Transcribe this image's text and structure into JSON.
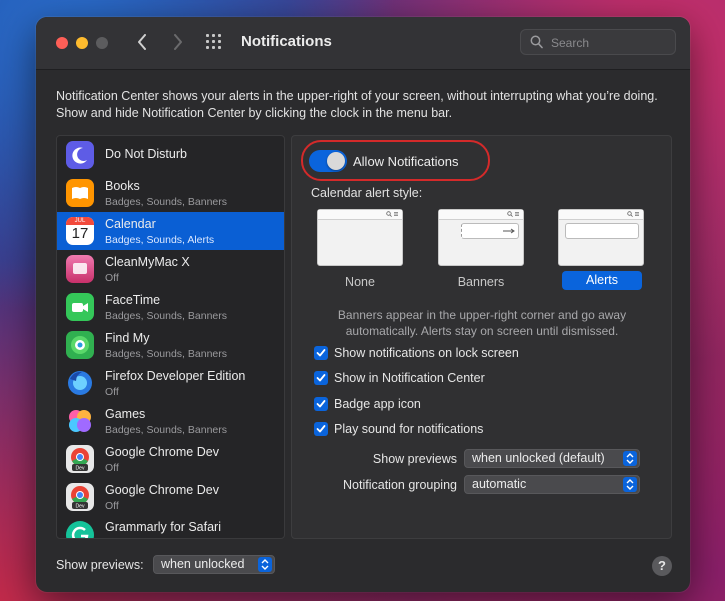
{
  "window": {
    "title": "Notifications"
  },
  "search": {
    "placeholder": "Search"
  },
  "description": "Notification Center shows your alerts in the upper-right of your screen, without interrupting what you’re doing. Show and hide Notification Center by clicking the clock in the menu bar.",
  "apps": [
    {
      "name": "Do Not Disturb",
      "sub": "",
      "icon": "moon-icon",
      "color": "#5e5ce6"
    },
    {
      "name": "Books",
      "sub": "Badges, Sounds, Banners",
      "icon": "books-icon",
      "color": "#ff9500"
    },
    {
      "name": "Calendar",
      "sub": "Badges, Sounds, Alerts",
      "icon": "calendar-icon",
      "color": "#ffffff",
      "selected": true
    },
    {
      "name": "CleanMyMac X",
      "sub": "Off",
      "icon": "cleanmymac-icon",
      "color": "#e0508a"
    },
    {
      "name": "FaceTime",
      "sub": "Badges, Sounds, Banners",
      "icon": "facetime-icon",
      "color": "#34c759"
    },
    {
      "name": "Find My",
      "sub": "Badges, Sounds, Banners",
      "icon": "findmy-icon",
      "color": "#30b050"
    },
    {
      "name": "Firefox Developer Edition",
      "sub": "Off",
      "icon": "firefox-icon",
      "color": "#2a7ae2"
    },
    {
      "name": "Games",
      "sub": "Badges, Sounds, Banners",
      "icon": "games-icon",
      "color": "#e04ae0"
    },
    {
      "name": "Google Chrome Dev",
      "sub": "Off",
      "icon": "chrome-dev-icon",
      "color": "#dddddd"
    },
    {
      "name": "Google Chrome Dev",
      "sub": "Off",
      "icon": "chrome-dev-icon",
      "color": "#dddddd"
    },
    {
      "name": "Grammarly for Safari",
      "sub": "",
      "icon": "grammarly-icon",
      "color": "#15c39a"
    }
  ],
  "calendar_icon": {
    "month": "JUL",
    "day": "17"
  },
  "allow_notifications": {
    "label": "Allow Notifications",
    "enabled": true
  },
  "alert_style": {
    "label": "Calendar alert style:",
    "options": [
      "None",
      "Banners",
      "Alerts"
    ],
    "selected": "Alerts"
  },
  "explanation": "Banners appear in the upper-right corner and go away automatically. Alerts stay on screen until dismissed.",
  "checkboxes": [
    {
      "label": "Show notifications on lock screen",
      "checked": true
    },
    {
      "label": "Show in Notification Center",
      "checked": true
    },
    {
      "label": "Badge app icon",
      "checked": true
    },
    {
      "label": "Play sound for notifications",
      "checked": true
    }
  ],
  "show_previews": {
    "label": "Show previews",
    "value": "when unlocked (default)"
  },
  "grouping": {
    "label": "Notification grouping",
    "value": "automatic"
  },
  "footer": {
    "label": "Show previews:",
    "value": "when unlocked"
  },
  "help": {
    "label": "?"
  },
  "colors": {
    "accent": "#0a64dc",
    "highlight_ring": "#d42a2a",
    "window_bg": "#2b2b2d"
  }
}
